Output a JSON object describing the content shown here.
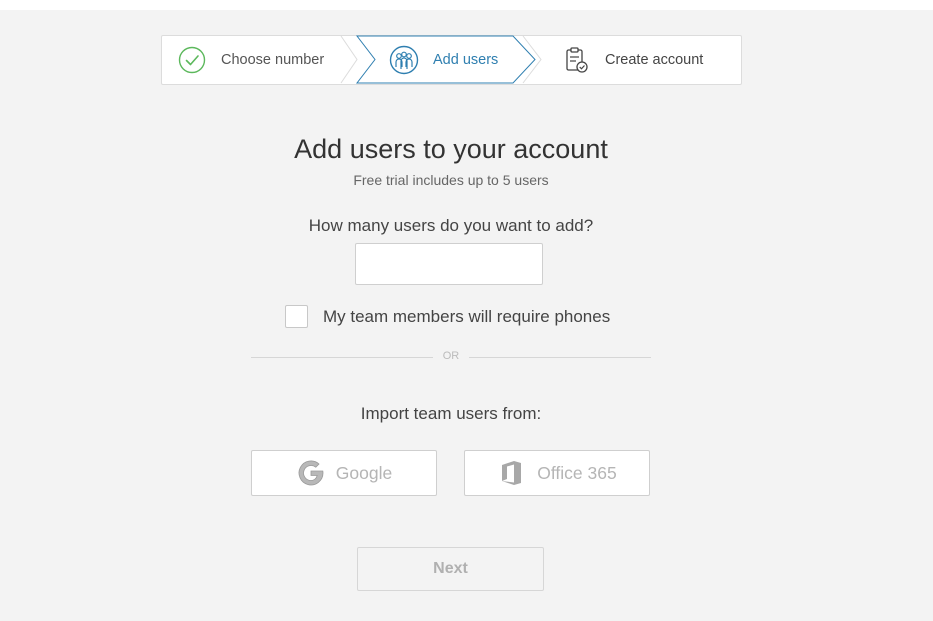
{
  "stepper": {
    "steps": [
      {
        "label": "Choose number",
        "icon": "check-circle-icon",
        "state": "done"
      },
      {
        "label": "Add users",
        "icon": "users-group-icon",
        "state": "active"
      },
      {
        "label": "Create account",
        "icon": "clipboard-check-icon",
        "state": "pending"
      }
    ]
  },
  "main": {
    "title": "Add users to your account",
    "subtitle": "Free trial includes up to 5 users",
    "question": "How many users do you want to add?",
    "users_input": {
      "value": "",
      "placeholder": ""
    },
    "phones_checkbox": {
      "label": "My team members will require phones",
      "checked": false
    },
    "divider_text": "OR",
    "import_label": "Import team users from:",
    "import_buttons": [
      {
        "label": "Google",
        "icon": "google-icon"
      },
      {
        "label": "Office 365",
        "icon": "office-icon"
      }
    ],
    "next_label": "Next"
  },
  "colors": {
    "accent": "#2f7fb0",
    "success": "#5cb85c",
    "background": "#f3f3f3"
  }
}
